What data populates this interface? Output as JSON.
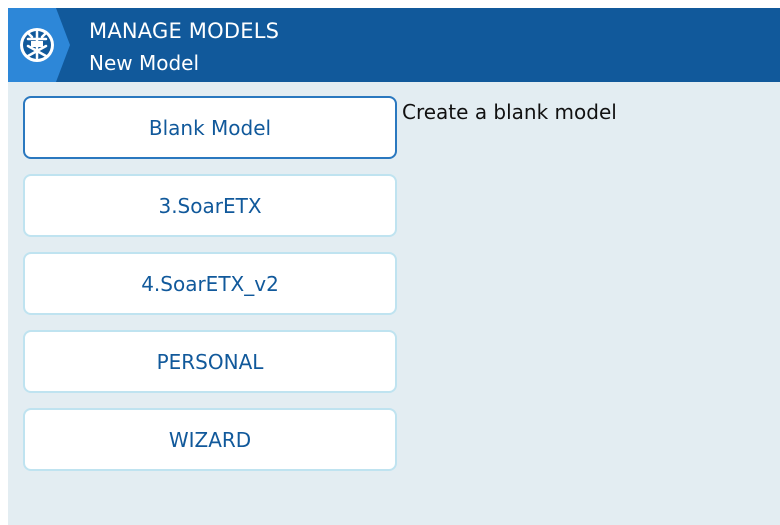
{
  "header": {
    "icon": "radio-menu-icon",
    "title": "MANAGE MODELS",
    "subtitle": "New Model",
    "bg_color": "#11599b"
  },
  "models": [
    {
      "label": "Blank Model",
      "selected": true
    },
    {
      "label": "3.SoarETX",
      "selected": false
    },
    {
      "label": "4.SoarETX_v2",
      "selected": false
    },
    {
      "label": "PERSONAL",
      "selected": false
    },
    {
      "label": "WIZARD",
      "selected": false
    }
  ],
  "description": "Create a blank model",
  "colors": {
    "accent": "#11599b",
    "background": "#e3edf2",
    "button_border": "#bfe3f0",
    "selected_border": "#2a78bf"
  }
}
